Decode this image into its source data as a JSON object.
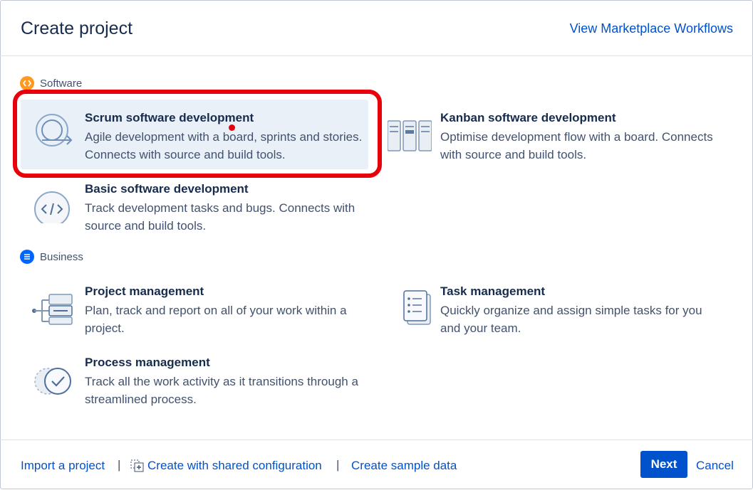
{
  "dialog": {
    "title": "Create project",
    "marketplace_link": "View Marketplace Workflows"
  },
  "sections": {
    "software": {
      "label": "Software",
      "icon": "code-brackets-icon",
      "color": "#ff991f"
    },
    "business": {
      "label": "Business",
      "icon": "list-icon",
      "color": "#0065ff"
    }
  },
  "templates": {
    "scrum": {
      "title": "Scrum software development",
      "desc": "Agile development with a board, sprints and stories. Connects with source and build tools.",
      "icon": "scrum-cycle-icon",
      "selected": true
    },
    "kanban": {
      "title": "Kanban software development",
      "desc": "Optimise development flow with a board. Connects with source and build tools.",
      "icon": "kanban-board-icon"
    },
    "basic": {
      "title": "Basic software development",
      "desc": "Track development tasks and bugs. Connects with source and build tools.",
      "icon": "code-icon"
    },
    "project_mgmt": {
      "title": "Project management",
      "desc": "Plan, track and report on all of your work within a project.",
      "icon": "project-tree-icon"
    },
    "task_mgmt": {
      "title": "Task management",
      "desc": "Quickly organize and assign simple tasks for you and your team.",
      "icon": "checklist-icon"
    },
    "process_mgmt": {
      "title": "Process management",
      "desc": "Track all the work activity as it transitions through a streamlined process.",
      "icon": "check-circle-icon"
    }
  },
  "footer": {
    "import": "Import a project",
    "shared_config": "Create with shared configuration",
    "sample_data": "Create sample data",
    "separator": "|",
    "next": "Next",
    "cancel": "Cancel"
  },
  "colors": {
    "accent": "#0052cc",
    "selected_bg": "#e9f0f8",
    "annotation_red": "#e8000b"
  }
}
